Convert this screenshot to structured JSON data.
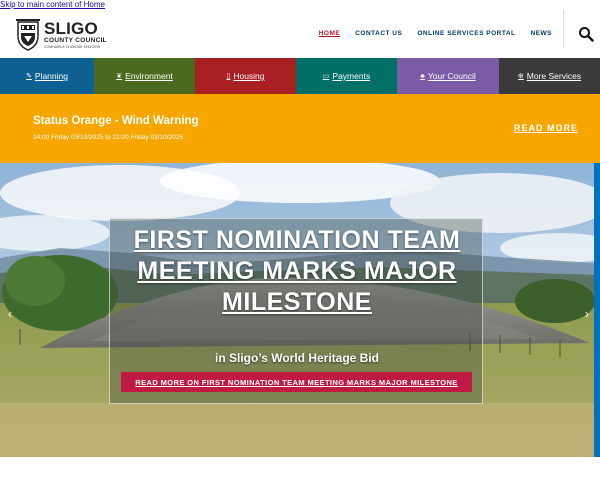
{
  "skip_link": "Skip to main content of Home",
  "brand": {
    "name": "SLIGO",
    "subtitle": "COUNTY COUNCIL",
    "irish": "COMHAIRLE CHONTAE SHLIGIGH"
  },
  "top_nav": [
    {
      "label": "HOME",
      "active": true
    },
    {
      "label": "CONTACT US",
      "active": false
    },
    {
      "label": "ONLINE SERVICES PORTAL",
      "active": false
    },
    {
      "label": "NEWS",
      "active": false
    }
  ],
  "search_icon": "search-icon",
  "main_nav": [
    {
      "label": "Planning",
      "icon": "pin-icon",
      "glyph": "✎",
      "color": "#0e5f92"
    },
    {
      "label": "Environment",
      "icon": "leaf-icon",
      "glyph": "❦",
      "color": "#4a6a1f"
    },
    {
      "label": "Housing",
      "icon": "building-icon",
      "glyph": "▯",
      "color": "#a82022"
    },
    {
      "label": "Payments",
      "icon": "card-icon",
      "glyph": "▭",
      "color": "#006f66"
    },
    {
      "label": "Your Council",
      "icon": "people-icon",
      "glyph": "♣",
      "color": "#7b5aa6"
    },
    {
      "label": "More Services",
      "icon": "plus-circle-icon",
      "glyph": "⊕",
      "color": "#3a3a3a"
    }
  ],
  "alert": {
    "title": "Status Orange - Wind Warning",
    "time": "14:00 Friday 03/10/2025 to 22:00 Friday 03/10/2025",
    "link": "READ MORE",
    "color": "#f7a600"
  },
  "hero": {
    "title": "FIRST NOMINATION TEAM MEETING MARKS MAJOR MILESTONE",
    "subtitle": "in Sligo’s World Heritage Bid",
    "button": "READ MORE ON FIRST NOMINATION TEAM MEETING MARKS MAJOR MILESTONE",
    "button_color": "#c01a43",
    "prev_icon": "chevron-left-icon",
    "next_icon": "chevron-right-icon"
  },
  "colors": {
    "accent": "#0072bc",
    "active_link": "#b8162e",
    "nav_text": "#003a70"
  }
}
